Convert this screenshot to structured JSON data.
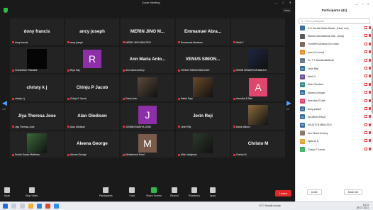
{
  "window": {
    "title": "Zoom Meeting",
    "view_label": "View",
    "controls": "— □ ✕"
  },
  "colors": {
    "accent": "#4aa3ff",
    "leave": "#e02828",
    "mic_muted": "#e33",
    "secure": "#2dbd4b"
  },
  "pager": {
    "prev_page": "1/2",
    "next_page": "1/2"
  },
  "tiles": [
    {
      "name": "dony francis",
      "label": "dony francis",
      "kind": "name"
    },
    {
      "name": "ancy joseph",
      "label": "ancy joseph",
      "kind": "name"
    },
    {
      "name": "MERIN JINO M...",
      "label": "MERIN JINO MBA 2021",
      "kind": "name"
    },
    {
      "name": "Emmanuel Abra...",
      "label": "Emmanuel Abraham",
      "kind": "name"
    },
    {
      "name": "",
      "label": "Akhil V",
      "kind": "dark"
    },
    {
      "name": "",
      "label": "Govardhan Prashant",
      "kind": "square-black"
    },
    {
      "name": "R",
      "label": "Riya Saji",
      "kind": "avatar",
      "color": "#8e2ea8"
    },
    {
      "name": "Ann Maria Anto...",
      "label": "Ann Maria Antony",
      "kind": "name"
    },
    {
      "name": "VENUS SIMON...",
      "label": "VENUS SIMON MBA 2020",
      "kind": "name"
    },
    {
      "name": "",
      "label": "SEBIN SEBASTIAN Batch A",
      "kind": "photo",
      "color": "#1d2740"
    },
    {
      "name": "christy k j",
      "label": "christy k j",
      "kind": "name"
    },
    {
      "name": "Chinju P Jacob",
      "label": "Chinju P Jacob",
      "kind": "name"
    },
    {
      "name": "",
      "label": "Danis Anto",
      "kind": "photo",
      "color": "#5a4a3a"
    },
    {
      "name": "",
      "label": "Nabin Saju",
      "kind": "photo",
      "color": "#6a4a2a"
    },
    {
      "name": "A",
      "label": "Amrutha S Nair",
      "kind": "avatar",
      "color": "#e0456c"
    },
    {
      "name": "Jiya Theresa Jose",
      "label": "Jiya Theresa Jose",
      "kind": "name"
    },
    {
      "name": "Alan Gledison",
      "label": "Alan Gledison",
      "kind": "name"
    },
    {
      "name": "J",
      "label": "JOSMIN MARIYA JOSE",
      "kind": "avatar",
      "color": "#8e2ea8"
    },
    {
      "name": "Jerin Reji",
      "label": "Jerin Reji",
      "kind": "name"
    },
    {
      "name": "",
      "label": "Davis Wilson",
      "kind": "photo",
      "color": "#8a6a3a"
    },
    {
      "name": "",
      "label": "Sneha Susan Mathews",
      "kind": "photo",
      "color": "#3a6a3a"
    },
    {
      "name": "Aleena George",
      "label": "Aleena George",
      "kind": "name"
    },
    {
      "name": "M",
      "label": "Mohammed Emal",
      "kind": "avatar",
      "color": "#7a5a4a"
    },
    {
      "name": "",
      "label": "Albin Varghese",
      "kind": "photo",
      "color": "#2a3a2a"
    },
    {
      "name": "Christo M",
      "label": "Christo M",
      "kind": "name"
    }
  ],
  "toolbar": {
    "items": [
      {
        "label": "Mute",
        "icon": "mic-icon"
      },
      {
        "label": "Stop Video",
        "icon": "camera-icon"
      },
      {
        "label": "Participants",
        "icon": "participants-icon",
        "badge": "41"
      },
      {
        "label": "Chat",
        "icon": "chat-icon"
      },
      {
        "label": "Share Screen",
        "icon": "share-screen-icon"
      },
      {
        "label": "Record",
        "icon": "record-icon"
      },
      {
        "label": "Reactions",
        "icon": "reactions-icon"
      },
      {
        "label": "Apps",
        "icon": "apps-icon"
      }
    ],
    "leave": "Leave"
  },
  "panel": {
    "title": "Participants (41)",
    "search_placeholder": "Find a participant",
    "participants": [
      {
        "initials": "",
        "name": "A G Suresh Babu Maria...(Host, me)",
        "color": "#3b6ea5"
      },
      {
        "initials": "",
        "name": "Marian International Inst...(Host)",
        "color": "#5a5a5a"
      },
      {
        "initials": "",
        "name": "Gundhin Acharya (Co-host)",
        "color": "#7a6a5a"
      },
      {
        "initials": "P",
        "name": "pme (Co-host)",
        "color": "#e89030"
      },
      {
        "initials": "",
        "name": "Dr. T V Muralivallabhan",
        "color": "#6a7a8a"
      },
      {
        "initials": "JR",
        "name": "Jerin Reji",
        "color": "#3b6ea5"
      },
      {
        "initials": "AV",
        "name": "Akhil V",
        "color": "#6a4aa0"
      },
      {
        "initials": "AG",
        "name": "Alan Gledison",
        "color": "#3b8a8a"
      },
      {
        "initials": "AG",
        "name": "Aleena George",
        "color": "#3b6ea5"
      },
      {
        "initials": "AS",
        "name": "Amrutha S Nair",
        "color": "#e0456c"
      },
      {
        "initials": "AJ",
        "name": "ancy joseph",
        "color": "#3b6ea5"
      },
      {
        "initials": "AS",
        "name": "ANJANA SHAJI",
        "color": "#3b6ea5"
      },
      {
        "initials": "AR",
        "name": "ANJU R B MBA 2021",
        "color": "#3b6ea5"
      },
      {
        "initials": "",
        "name": "Ann Maria Antony",
        "color": "#8a7a6a"
      },
      {
        "initials": "AS",
        "name": "Aparna S",
        "color": "#e0a030"
      },
      {
        "initials": "C",
        "name": "Chinju P Jacob",
        "color": "#3bb060"
      }
    ],
    "invite": "Invite",
    "mute_me": "Mute Me"
  },
  "taskbar": {
    "weather": "21°C  Mostly cloudy",
    "time": "10:11",
    "date": "28-07-2021"
  }
}
